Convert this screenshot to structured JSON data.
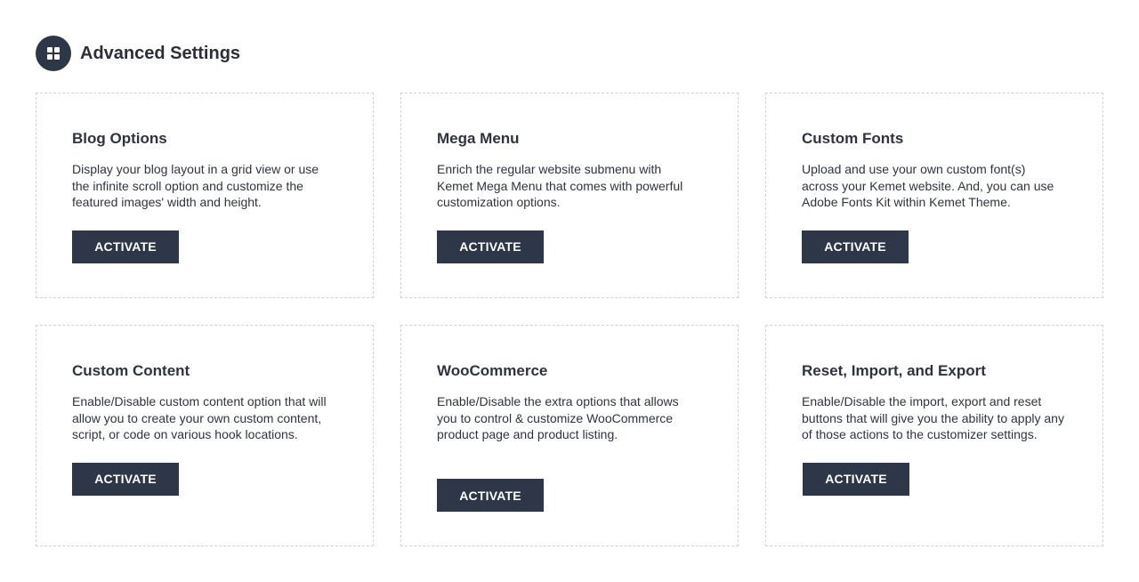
{
  "header": {
    "title": "Advanced Settings",
    "icon": "grid-icon"
  },
  "colors": {
    "accent": "#2d3748",
    "border": "#cfd3d9"
  },
  "cards": [
    {
      "title": "Blog Options",
      "description": "Display your blog layout in a grid view or use the infinite scroll option and customize the featured images' width and height.",
      "button_label": "ACTIVATE"
    },
    {
      "title": "Mega Menu",
      "description": "Enrich the regular website submenu with Kemet Mega Menu that comes with powerful customization options.",
      "button_label": "ACTIVATE"
    },
    {
      "title": "Custom Fonts",
      "description": "Upload and use your own custom font(s) across your Kemet website. And, you can use Adobe Fonts Kit within Kemet Theme.",
      "button_label": "ACTIVATE"
    },
    {
      "title": "Custom Content",
      "description": "Enable/Disable custom content option that will allow you to create your own custom content, script, or code on various hook locations.",
      "button_label": "ACTIVATE"
    },
    {
      "title": "WooCommerce",
      "description": "Enable/Disable the extra options that allows you to control & customize WooCommerce product page and product listing.",
      "button_label": "ACTIVATE"
    },
    {
      "title": "Reset, Import, and Export",
      "description": "Enable/Disable the import, export and reset buttons that will give you the ability to apply any of those actions to the customizer settings.",
      "button_label": "ACTIVATE"
    }
  ]
}
